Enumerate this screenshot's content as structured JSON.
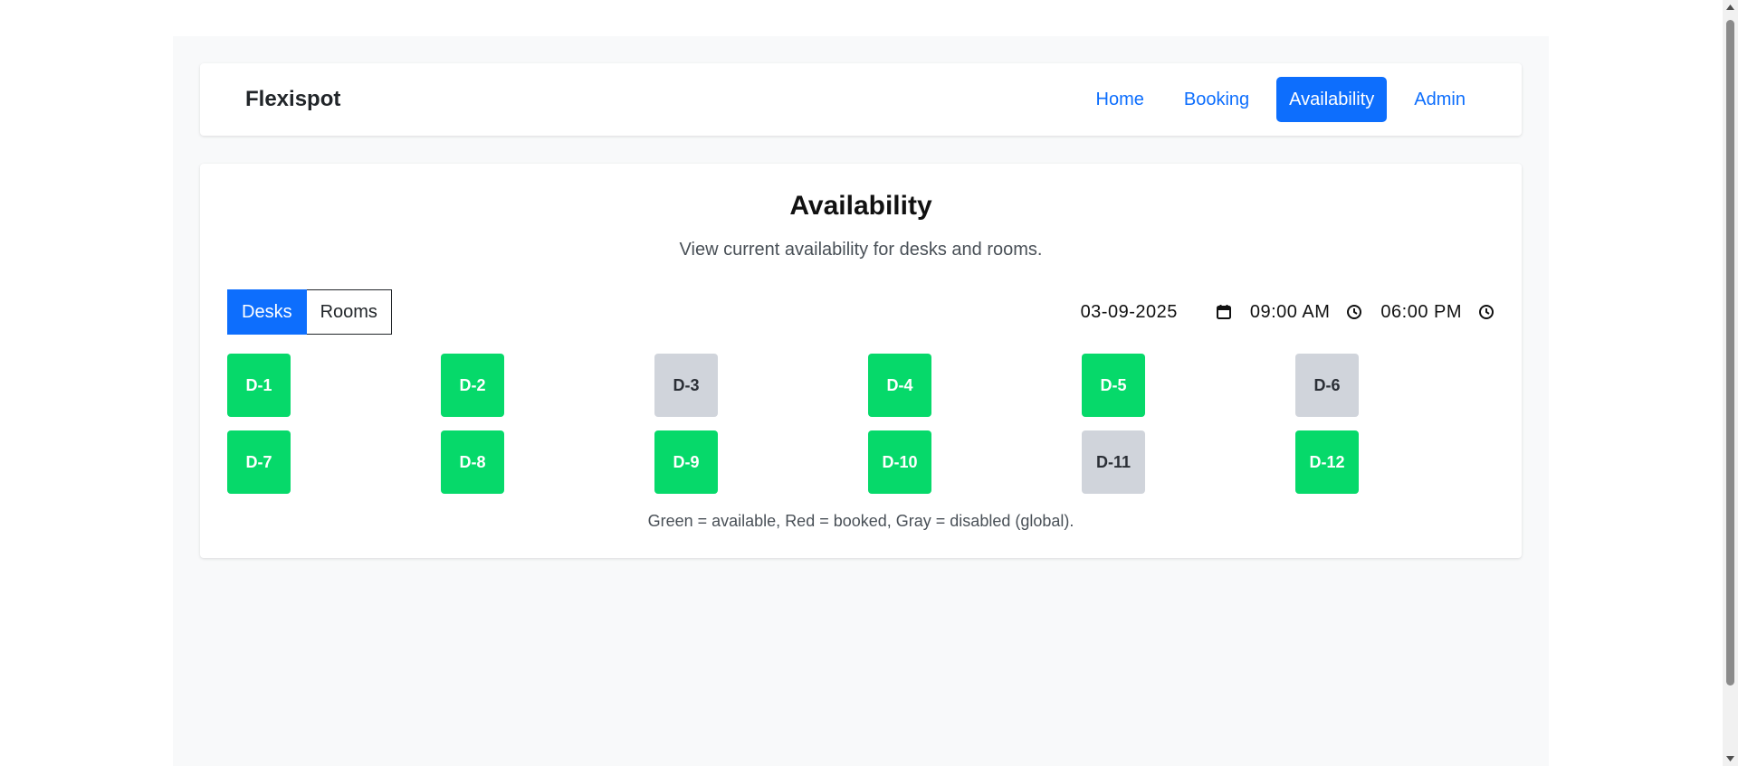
{
  "navbar": {
    "brand": "Flexispot",
    "links": [
      {
        "label": "Home",
        "active": false
      },
      {
        "label": "Booking",
        "active": false
      },
      {
        "label": "Availability",
        "active": true
      },
      {
        "label": "Admin",
        "active": false
      }
    ]
  },
  "page": {
    "title": "Availability",
    "subtitle": "View current availability for desks and rooms."
  },
  "toggle": {
    "desks_label": "Desks",
    "rooms_label": "Rooms",
    "selected": "Desks"
  },
  "filters": {
    "date": "03-09-2025",
    "start_time": "09:00 AM",
    "end_time": "06:00 PM",
    "date_icon": "calendar-icon",
    "time_icon": "clock-icon"
  },
  "desks": [
    {
      "label": "D-1",
      "status": "available"
    },
    {
      "label": "D-2",
      "status": "available"
    },
    {
      "label": "D-3",
      "status": "disabled"
    },
    {
      "label": "D-4",
      "status": "available"
    },
    {
      "label": "D-5",
      "status": "available"
    },
    {
      "label": "D-6",
      "status": "disabled"
    },
    {
      "label": "D-7",
      "status": "available"
    },
    {
      "label": "D-8",
      "status": "available"
    },
    {
      "label": "D-9",
      "status": "available"
    },
    {
      "label": "D-10",
      "status": "available"
    },
    {
      "label": "D-11",
      "status": "disabled"
    },
    {
      "label": "D-12",
      "status": "available"
    }
  ],
  "legend": "Green = available, Red = booked, Gray = disabled (global).",
  "colors": {
    "primary": "#0d6efd",
    "available": "#06d96a",
    "disabled": "#d0d4db",
    "booked": "#dc3545"
  }
}
